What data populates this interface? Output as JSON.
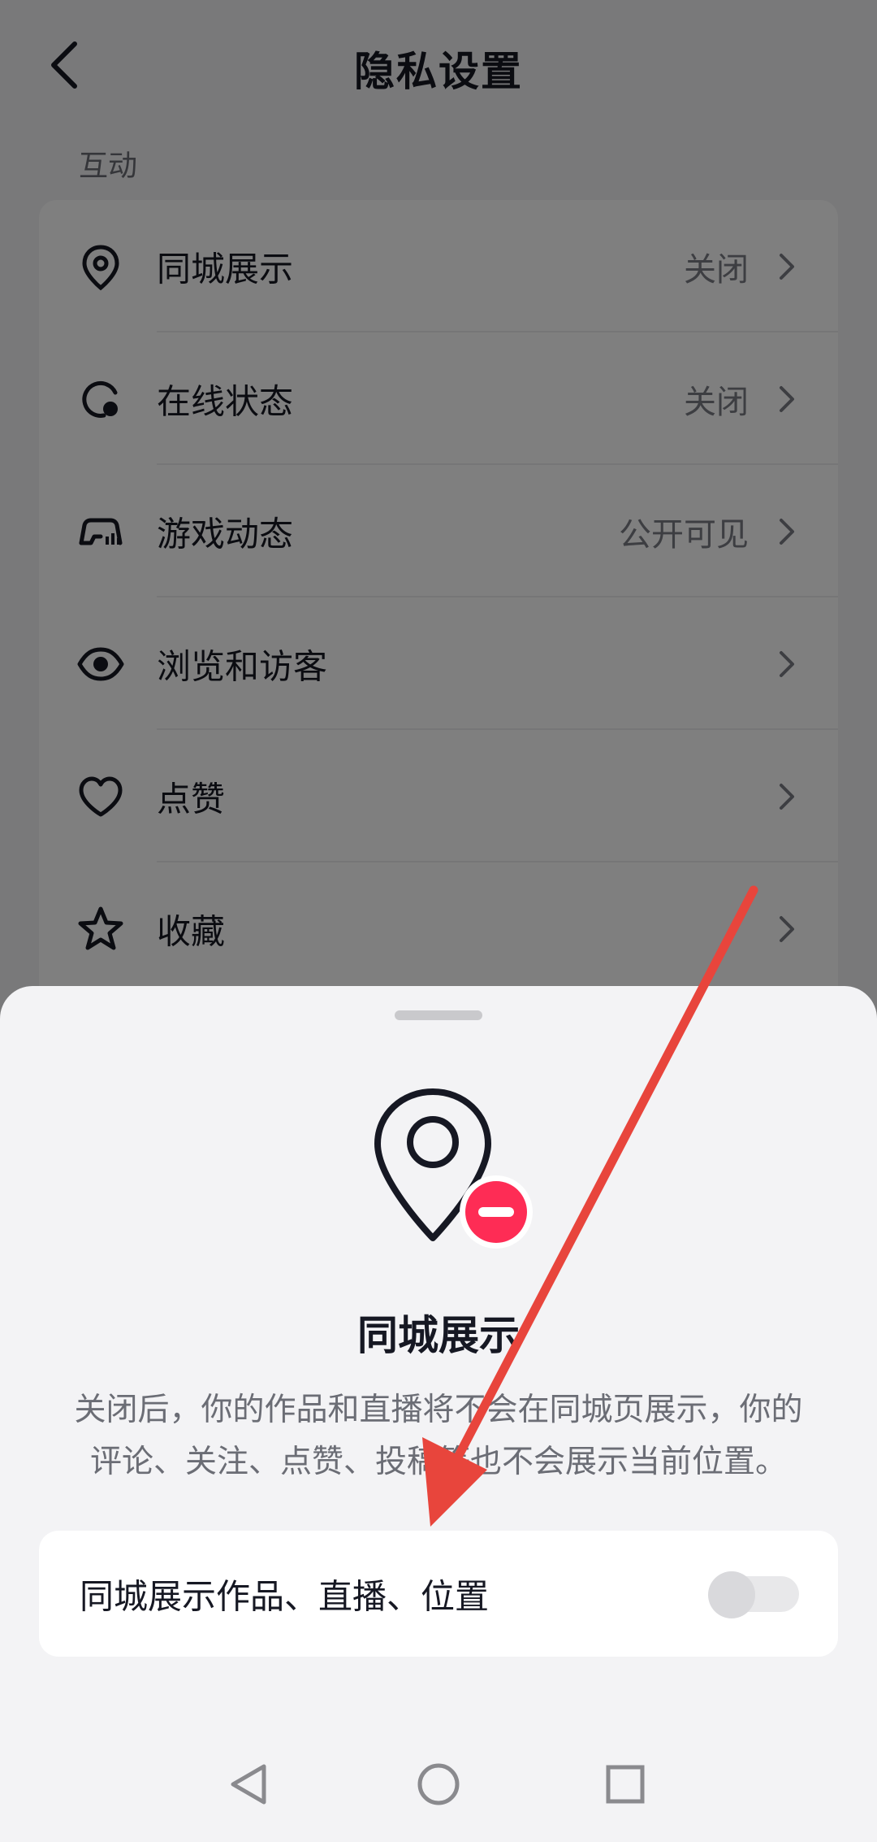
{
  "header": {
    "title": "隐私设置"
  },
  "section": {
    "label": "互动"
  },
  "settings": [
    {
      "icon": "location-pin-icon",
      "label": "同城展示",
      "value": "关闭"
    },
    {
      "icon": "online-status-icon",
      "label": "在线状态",
      "value": "关闭"
    },
    {
      "icon": "gamepad-icon",
      "label": "游戏动态",
      "value": "公开可见"
    },
    {
      "icon": "eye-icon",
      "label": "浏览和访客",
      "value": ""
    },
    {
      "icon": "heart-icon",
      "label": "点赞",
      "value": ""
    },
    {
      "icon": "star-icon",
      "label": "收藏",
      "value": ""
    }
  ],
  "sheet": {
    "title": "同城展示",
    "description_line1": "关闭后，你的作品和直播将不会在同城页展示，你的",
    "description_line2": "评论、关注、点赞、投稿等也不会展示当前位置。",
    "toggle": {
      "label": "同城展示作品、直播、位置",
      "on": false
    }
  },
  "colors": {
    "accent_red": "#fe2c55",
    "annotation_arrow": "#e8453c",
    "text_primary": "#161823",
    "text_secondary": "#6b6d75"
  }
}
